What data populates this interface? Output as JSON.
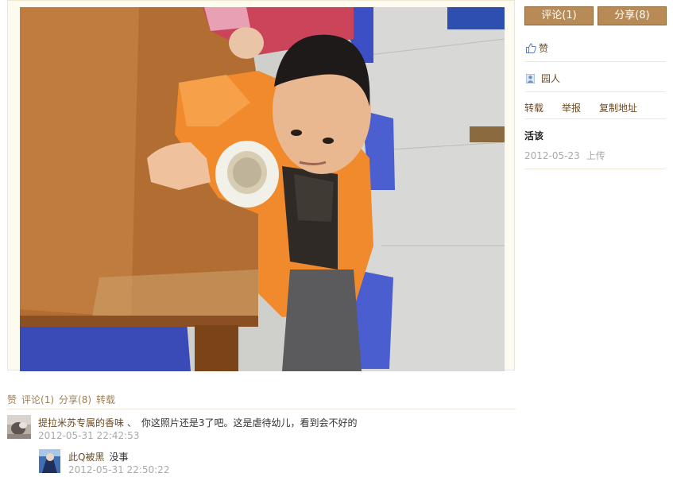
{
  "sidebar": {
    "comment_button": "评论(1)",
    "share_button": "分享(8)",
    "like_label": "赞",
    "author_name": "园人",
    "actions": {
      "repost": "转载",
      "report": "举报",
      "copy_link": "复制地址"
    },
    "photo_title": "活该",
    "upload_date": "2012-05-23",
    "upload_label": "上传"
  },
  "social_bar": {
    "like": "赞",
    "comment": "评论(1)",
    "share": "分享(8)",
    "repost": "转载"
  },
  "comments": [
    {
      "author": "提拉米苏专属的香味 、",
      "text": "你这照片还是3了吧。这是虐待幼儿，看到会不好的",
      "time": "2012-05-31 22:42:53"
    },
    {
      "author": "此Q被黑",
      "text": "没事",
      "time": "2012-05-31 22:50:22"
    }
  ],
  "colors": {
    "button_bg": "#b88a55",
    "link": "#6b4a22",
    "muted": "#aaaaaa",
    "divider": "#eee6d6"
  },
  "icons": {
    "thumb": "thumbs-up-icon",
    "user": "user-icon"
  }
}
